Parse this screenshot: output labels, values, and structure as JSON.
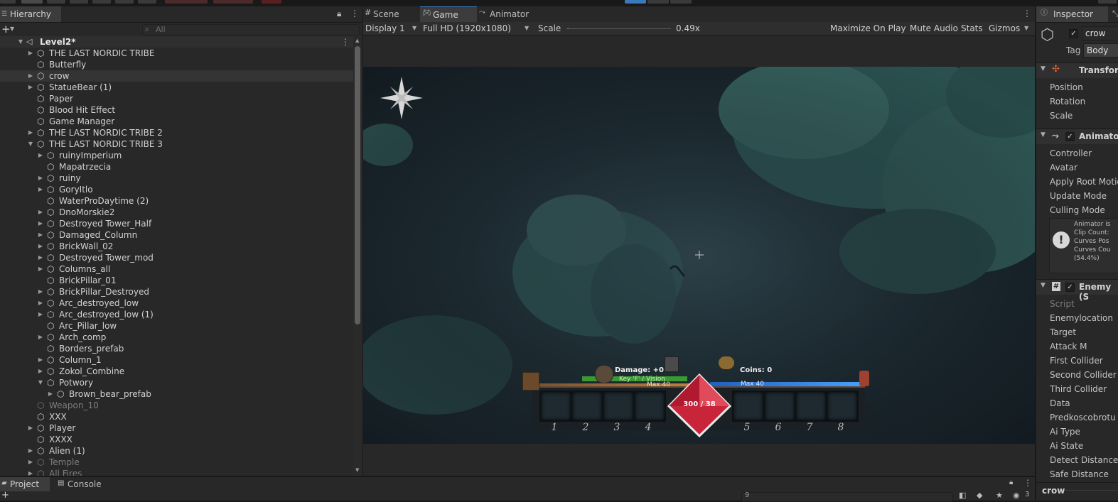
{
  "colors": {
    "panel": "#282828",
    "selection": "#343434",
    "accent": "#3a79bb",
    "health": "#c8243a"
  },
  "hierarchy": {
    "tab_label": "Hierarchy",
    "add_label": "+",
    "search_placeholder": "All",
    "scene_name": "Level2*",
    "items": [
      {
        "label": "THE LAST NORDIC TRIBE",
        "depth": 0,
        "arrow": "▶",
        "dim": false,
        "sel": false
      },
      {
        "label": "Butterfly",
        "depth": 0,
        "arrow": "",
        "dim": false,
        "sel": false
      },
      {
        "label": "crow",
        "depth": 0,
        "arrow": "▶",
        "dim": false,
        "sel": true
      },
      {
        "label": "StatueBear (1)",
        "depth": 0,
        "arrow": "▶",
        "dim": false,
        "sel": false
      },
      {
        "label": "Paper",
        "depth": 0,
        "arrow": "",
        "dim": false,
        "sel": false
      },
      {
        "label": "Blood Hit Effect",
        "depth": 0,
        "arrow": "",
        "dim": false,
        "sel": false
      },
      {
        "label": "Game Manager",
        "depth": 0,
        "arrow": "",
        "dim": false,
        "sel": false
      },
      {
        "label": "THE LAST NORDIC TRIBE 2",
        "depth": 0,
        "arrow": "▶",
        "dim": false,
        "sel": false
      },
      {
        "label": "THE LAST NORDIC TRIBE 3",
        "depth": 0,
        "arrow": "▼",
        "dim": false,
        "sel": false
      },
      {
        "label": "ruinyImperium",
        "depth": 1,
        "arrow": "▶",
        "dim": false,
        "sel": false
      },
      {
        "label": "Mapatrzecia",
        "depth": 1,
        "arrow": "",
        "dim": false,
        "sel": false
      },
      {
        "label": "ruiny",
        "depth": 1,
        "arrow": "▶",
        "dim": false,
        "sel": false
      },
      {
        "label": "GoryItlo",
        "depth": 1,
        "arrow": "▶",
        "dim": false,
        "sel": false
      },
      {
        "label": "WaterProDaytime (2)",
        "depth": 1,
        "arrow": "",
        "dim": false,
        "sel": false
      },
      {
        "label": "DnoMorskie2",
        "depth": 1,
        "arrow": "▶",
        "dim": false,
        "sel": false
      },
      {
        "label": "Destroyed Tower_Half",
        "depth": 1,
        "arrow": "▶",
        "dim": false,
        "sel": false
      },
      {
        "label": "Damaged_Column",
        "depth": 1,
        "arrow": "▶",
        "dim": false,
        "sel": false
      },
      {
        "label": "BrickWall_02",
        "depth": 1,
        "arrow": "▶",
        "dim": false,
        "sel": false
      },
      {
        "label": "Destroyed Tower_mod",
        "depth": 1,
        "arrow": "▶",
        "dim": false,
        "sel": false
      },
      {
        "label": "Columns_all",
        "depth": 1,
        "arrow": "▶",
        "dim": false,
        "sel": false
      },
      {
        "label": "BrickPillar_01",
        "depth": 1,
        "arrow": "",
        "dim": false,
        "sel": false
      },
      {
        "label": "BrickPillar_Destroyed",
        "depth": 1,
        "arrow": "▶",
        "dim": false,
        "sel": false
      },
      {
        "label": "Arc_destroyed_low",
        "depth": 1,
        "arrow": "▶",
        "dim": false,
        "sel": false
      },
      {
        "label": "Arc_destroyed_low (1)",
        "depth": 1,
        "arrow": "▶",
        "dim": false,
        "sel": false
      },
      {
        "label": "Arc_Pillar_low",
        "depth": 1,
        "arrow": "",
        "dim": false,
        "sel": false
      },
      {
        "label": "Arch_comp",
        "depth": 1,
        "arrow": "▶",
        "dim": false,
        "sel": false
      },
      {
        "label": "Borders_prefab",
        "depth": 1,
        "arrow": "",
        "dim": false,
        "sel": false
      },
      {
        "label": "Column_1",
        "depth": 1,
        "arrow": "▶",
        "dim": false,
        "sel": false
      },
      {
        "label": "Zokol_Combine",
        "depth": 1,
        "arrow": "▶",
        "dim": false,
        "sel": false
      },
      {
        "label": "Potwory",
        "depth": 1,
        "arrow": "▼",
        "dim": false,
        "sel": false
      },
      {
        "label": "Brown_bear_prefab",
        "depth": 2,
        "arrow": "▶",
        "dim": false,
        "sel": false
      },
      {
        "label": "Weapon_10",
        "depth": 0,
        "arrow": "",
        "dim": true,
        "sel": false
      },
      {
        "label": "XXX",
        "depth": 0,
        "arrow": "",
        "dim": false,
        "sel": false
      },
      {
        "label": "Player",
        "depth": 0,
        "arrow": "▶",
        "dim": false,
        "sel": false
      },
      {
        "label": "XXXX",
        "depth": 0,
        "arrow": "",
        "dim": false,
        "sel": false
      },
      {
        "label": "Alien (1)",
        "depth": 0,
        "arrow": "▶",
        "dim": false,
        "sel": false
      },
      {
        "label": "Temple",
        "depth": 0,
        "arrow": "▶",
        "dim": true,
        "sel": false
      },
      {
        "label": "All Fires",
        "depth": 0,
        "arrow": "▶",
        "dim": true,
        "sel": false
      }
    ]
  },
  "game": {
    "tabs": [
      "Scene",
      "Game",
      "Animator"
    ],
    "display": "Display 1",
    "resolution": "Full HD (1920x1080)",
    "scale_label": "Scale",
    "scale_value": "0.49x",
    "scale_fraction": 0.49,
    "maximize": "Maximize On Play",
    "mute": "Mute Audio",
    "stats": "Stats",
    "gizmos": "Gizmos",
    "hud": {
      "damage": "Damage: +0",
      "key_hint": "Key 'F' / Vision",
      "max_left": "Max 40",
      "max_right": "Max 40",
      "coins": "Coins: 0",
      "health": "300 / 38",
      "slots": [
        "1",
        "2",
        "3",
        "4",
        "5",
        "6",
        "7",
        "8"
      ]
    }
  },
  "inspector": {
    "tab_label": "Inspector",
    "object_name": "crow",
    "tag_label": "Tag",
    "tag_value": "Body",
    "transform": {
      "title": "Transfor",
      "props": [
        "Position",
        "Rotation",
        "Scale"
      ]
    },
    "animator": {
      "title": "Animato",
      "props": [
        "Controller",
        "Avatar",
        "Apply Root Motio",
        "Update Mode",
        "Culling Mode"
      ],
      "info": [
        "Animator is",
        "Clip Count:",
        "Curves Pos",
        "Curves Cou",
        "(54.4%)"
      ]
    },
    "enemy": {
      "title": "Enemy (S",
      "props": [
        "Script",
        "Enemylocation",
        "Target",
        "Attack M",
        "First Collider",
        "Second Collider",
        "Third Collider",
        "Data",
        "Predkoscobrotu",
        "Ai Type",
        "Ai State",
        "Detect Distance",
        "Safe Distance"
      ]
    },
    "footer_label": "crow"
  },
  "bottom": {
    "tabs": [
      "Project",
      "Console"
    ],
    "add_label": "+",
    "search_value": "9",
    "count": "3"
  }
}
